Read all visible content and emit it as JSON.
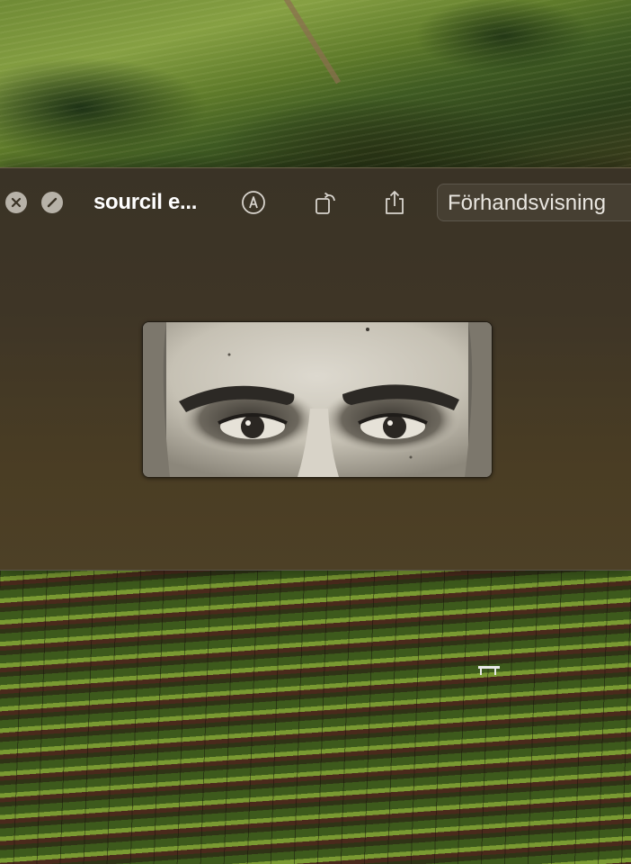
{
  "window": {
    "title": "sourcil e...",
    "open_with_label": "Förhandsvisning"
  },
  "icons": {
    "close": "close-icon",
    "no_effect": "slash-circle-icon",
    "markup": "markup-pen-icon",
    "rotate": "rotate-icon",
    "share": "share-icon"
  },
  "colors": {
    "window_bg": "#3e3526",
    "title_text": "#ffffff",
    "button_text": "#e9e6e0"
  }
}
